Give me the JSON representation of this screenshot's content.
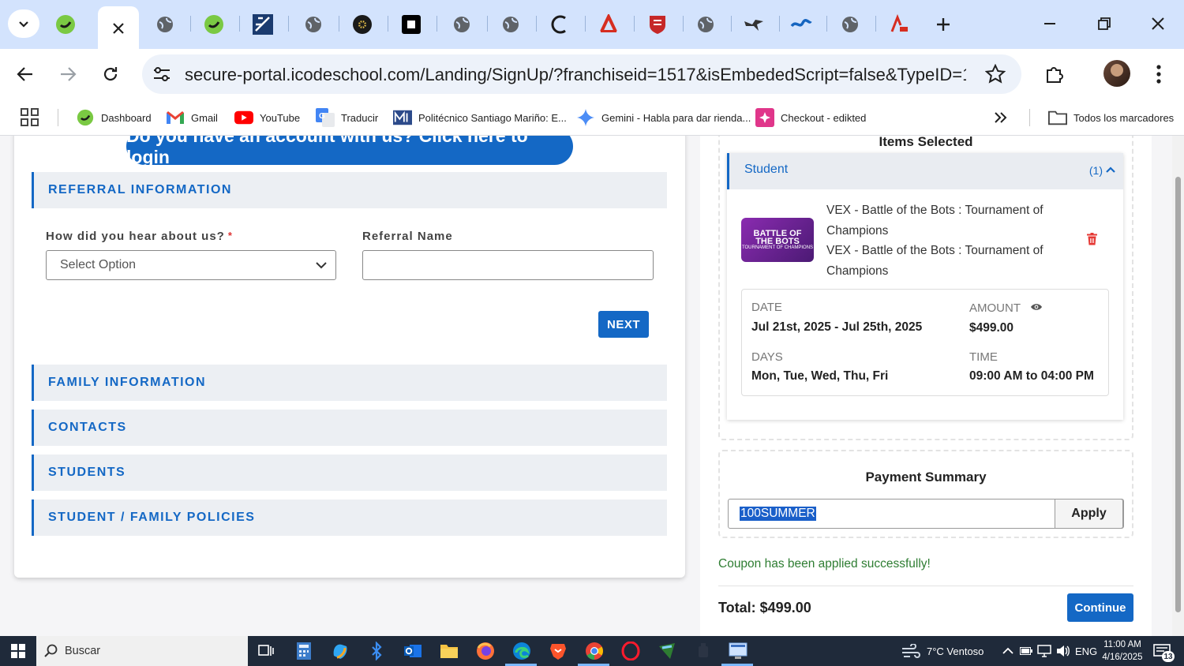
{
  "browser": {
    "tabs": [
      "tab-1",
      "tab-2-active",
      "tab-3",
      "tab-4",
      "tab-5",
      "tab-6",
      "tab-7",
      "tab-8",
      "tab-9",
      "tab-10",
      "tab-11",
      "tab-12",
      "tab-13",
      "tab-14",
      "tab-15",
      "tab-16",
      "tab-17"
    ],
    "url": "secure-portal.icodeschool.com/Landing/SignUp/?franchiseid=1517&isEmbededScript=false&TypeID=19&...",
    "bookmarks": [
      {
        "label": "Dashboard"
      },
      {
        "label": "Gmail"
      },
      {
        "label": "YouTube"
      },
      {
        "label": "Traducir"
      },
      {
        "label": "Politécnico Santiago Mariño: E..."
      },
      {
        "label": "Gemini - Habla para dar rienda..."
      },
      {
        "label": "Checkout - edikted"
      }
    ],
    "all_bookmarks": "Todos los marcadores"
  },
  "form": {
    "login_cta": "Do you have an account with us? Click here to login",
    "sections": {
      "referral": "REFERRAL INFORMATION",
      "family": "FAMILY INFORMATION",
      "contacts": "CONTACTS",
      "students": "STUDENTS",
      "policies": "STUDENT / FAMILY POLICIES"
    },
    "hear_label": "How did you hear about us?",
    "required_mark": "*",
    "hear_select_value": "Select Option",
    "referral_name_label": "Referral Name",
    "referral_name_value": "",
    "next_label": "NEXT"
  },
  "cart": {
    "title": "Items Selected",
    "group_label": "Student",
    "group_count": "(1)",
    "product_image_text": [
      "BATTLE OF",
      "THE BOTS",
      "TOURNAMENT OF CHAMPIONS"
    ],
    "product_line_1": "VEX - Battle of the Bots : Tournament of Champions",
    "product_line_2": "VEX - Battle of the Bots : Tournament of Champions",
    "date_label": "DATE",
    "date_value": "Jul 21st, 2025 - Jul 25th, 2025",
    "amount_label": "AMOUNT",
    "amount_value": "$499.00",
    "days_label": "DAYS",
    "days_value": "Mon, Tue, Wed, Thu, Fri",
    "time_label": "TIME",
    "time_value": "09:00 AM to 04:00 PM"
  },
  "payment": {
    "title": "Payment Summary",
    "coupon_value": "100SUMMER",
    "apply_label": "Apply",
    "coupon_message": "Coupon has been applied successfully!",
    "total": "Total: $499.00",
    "continue_label": "Continue"
  },
  "taskbar": {
    "search_placeholder": "Buscar",
    "weather": "7°C  Ventoso",
    "lang": "ENG",
    "time": "11:00 AM",
    "date": "4/16/2025",
    "notif_count": "13"
  },
  "colors": {
    "accent": "#1468c5",
    "tabstrip": "#d3e3fd",
    "success": "#2e7d32",
    "taskbar": "#1f2a3a"
  }
}
